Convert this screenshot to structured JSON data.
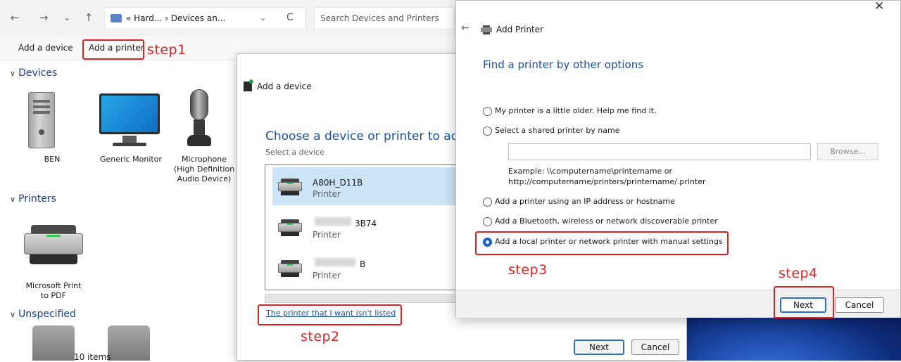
{
  "explorer": {
    "nav": {
      "back": "←",
      "forward": "→",
      "recent": "⌄",
      "up": "↑"
    },
    "address": {
      "prefix": "«",
      "path": "Hard... › Devices an...",
      "dropdown": "⌄",
      "refresh": "C"
    },
    "search_placeholder": "Search Devices and Printers",
    "toolbar": {
      "add_device": "Add a device",
      "add_printer": "Add a printer"
    },
    "sections": {
      "devices": "Devices",
      "printers": "Printers",
      "unspecified": "Unspecified"
    },
    "devices": [
      {
        "label": "BEN"
      },
      {
        "label": "Generic Monitor"
      },
      {
        "label_lines": [
          "Microphone",
          "(High Definition",
          "Audio Device)"
        ]
      }
    ],
    "printers": [
      {
        "label_lines": [
          "Microsoft Print",
          "to PDF"
        ]
      }
    ],
    "status": "10 items"
  },
  "annotations": {
    "step1": "step1",
    "step2": "step2",
    "step3": "step3",
    "step4": "step4"
  },
  "add_device_dialog": {
    "title": "Add a device",
    "heading": "Choose a device or printer to add t",
    "subheading": "Select a device",
    "items": [
      {
        "name": "A80H_D11B",
        "type": "Printer",
        "selected": true
      },
      {
        "name": "3B74",
        "type": "Printer",
        "selected": false
      },
      {
        "name": "B",
        "type": "Printer",
        "selected": false
      }
    ],
    "link": "The printer that I want isn't listed",
    "next": "Next",
    "cancel": "Cancel"
  },
  "add_printer_dialog": {
    "close": "✕",
    "back": "←",
    "title": "Add Printer",
    "heading": "Find a printer by other options",
    "options": [
      {
        "label": "My printer is a little older. Help me find it.",
        "checked": false
      },
      {
        "label": "Select a shared printer by name",
        "checked": false
      },
      {
        "label": "Add a printer using an IP address or hostname",
        "checked": false
      },
      {
        "label": "Add a Bluetooth, wireless or network discoverable printer",
        "checked": false
      },
      {
        "label": "Add a local printer or network printer with manual settings",
        "checked": true
      }
    ],
    "shared_name_value": "",
    "browse": "Browse...",
    "example_line1": "Example: \\\\computername\\printername or",
    "example_line2": "http://computername/printers/printername/.printer",
    "next": "Next",
    "cancel": "Cancel"
  }
}
